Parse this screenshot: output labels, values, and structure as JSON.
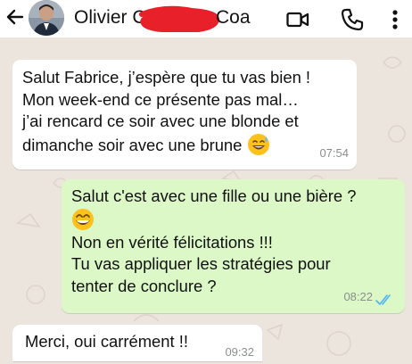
{
  "header": {
    "contact_first": "Olivier C",
    "contact_last": "Coa",
    "back_icon": "back-arrow-icon",
    "video_icon": "video-call-icon",
    "call_icon": "phone-icon",
    "menu_icon": "more-vert-icon"
  },
  "messages": [
    {
      "direction": "incoming",
      "lines": [
        "Salut Fabrice, j’espère que tu vas bien !",
        "Mon week-end ce présente pas mal…",
        "j’ai rencard ce soir avec une blonde et",
        "dimanche soir avec une brune"
      ],
      "emoji": "sweat-smile-emoji",
      "time": "07:54"
    },
    {
      "direction": "outgoing",
      "lines": [
        "Salut c'est avec une fille ou une bière ?",
        "Non en vérité félicitations !!!",
        "Tu vas appliquer les stratégies pour",
        "tenter de conclure ?"
      ],
      "emoji": "grin-emoji",
      "time": "08:22",
      "status": "read"
    },
    {
      "direction": "incoming",
      "lines": [
        "Merci, oui carrément !!"
      ],
      "time": "09:32"
    }
  ],
  "colors": {
    "chat_background": "#ece5dd",
    "incoming_bubble": "#ffffff",
    "outgoing_bubble": "#dcf8c6",
    "read_ticks": "#4fb3f6",
    "redaction": "#e8202a"
  }
}
